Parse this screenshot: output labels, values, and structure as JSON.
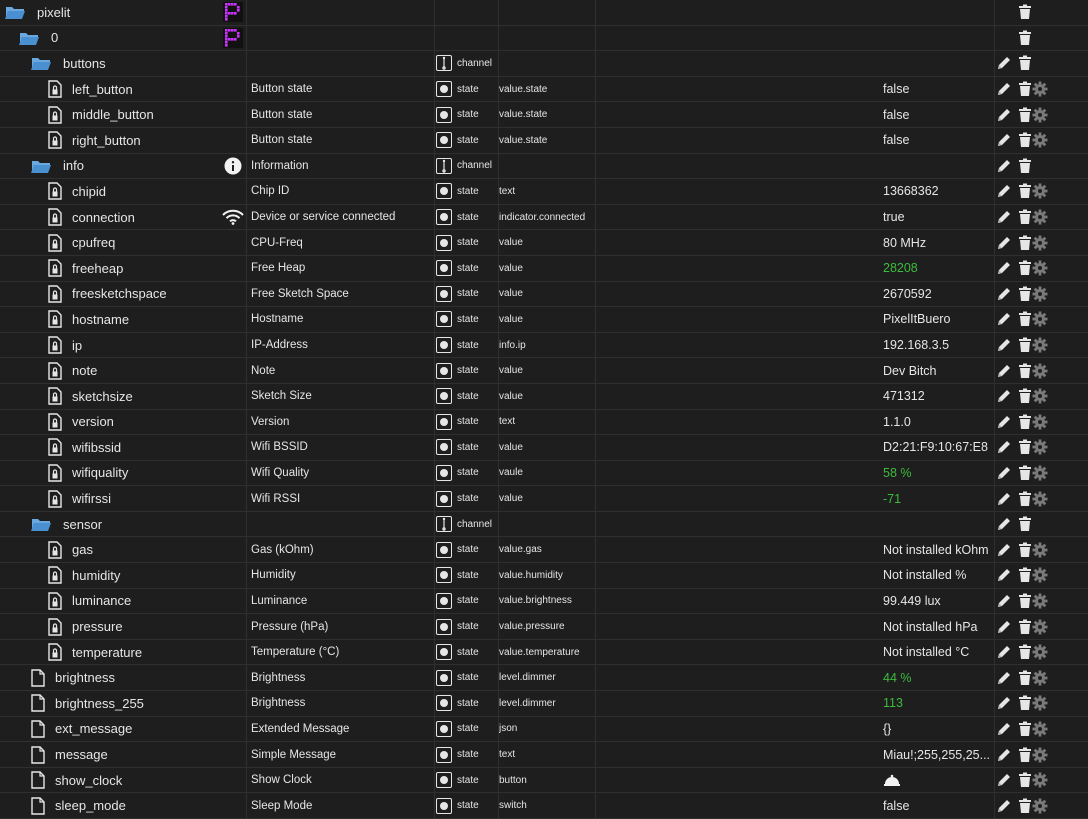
{
  "rows": [
    {
      "name": "pixelit",
      "indent": 0,
      "kind": "folder",
      "icon": "pixel-p",
      "desc": "",
      "type": "",
      "role": "",
      "value": "",
      "actions": [
        "delete"
      ]
    },
    {
      "name": "0",
      "indent": 1,
      "kind": "folder",
      "icon": "pixel-p",
      "desc": "",
      "type": "",
      "role": "",
      "value": "",
      "actions": [
        "delete"
      ]
    },
    {
      "name": "buttons",
      "indent": 2,
      "kind": "folder",
      "icon": "",
      "desc": "",
      "type": "channel",
      "role": "",
      "value": "",
      "actions": [
        "edit",
        "delete"
      ]
    },
    {
      "name": "left_button",
      "indent": 3,
      "kind": "state",
      "icon": "",
      "desc": "Button state",
      "type": "state",
      "role": "value.state",
      "value": "false",
      "actions": [
        "edit",
        "delete",
        "gear"
      ]
    },
    {
      "name": "middle_button",
      "indent": 3,
      "kind": "state",
      "icon": "",
      "desc": "Button state",
      "type": "state",
      "role": "value.state",
      "value": "false",
      "actions": [
        "edit",
        "delete",
        "gear"
      ]
    },
    {
      "name": "right_button",
      "indent": 3,
      "kind": "state",
      "icon": "",
      "desc": "Button state",
      "type": "state",
      "role": "value.state",
      "value": "false",
      "actions": [
        "edit",
        "delete",
        "gear"
      ]
    },
    {
      "name": "info",
      "indent": 2,
      "kind": "folder",
      "icon": "info",
      "desc": "Information",
      "type": "channel",
      "role": "",
      "value": "",
      "actions": [
        "edit",
        "delete"
      ]
    },
    {
      "name": "chipid",
      "indent": 3,
      "kind": "state",
      "icon": "",
      "desc": "Chip ID",
      "type": "state",
      "role": "text",
      "value": "13668362",
      "actions": [
        "edit",
        "delete",
        "gear"
      ]
    },
    {
      "name": "connection",
      "indent": 3,
      "kind": "state",
      "icon": "wifi",
      "desc": "Device or service connected",
      "type": "state",
      "role": "indicator.connected",
      "value": "true",
      "actions": [
        "edit",
        "delete",
        "gear"
      ]
    },
    {
      "name": "cpufreq",
      "indent": 3,
      "kind": "state",
      "icon": "",
      "desc": "CPU-Freq",
      "type": "state",
      "role": "value",
      "value": "80 MHz",
      "actions": [
        "edit",
        "delete",
        "gear"
      ]
    },
    {
      "name": "freeheap",
      "indent": 3,
      "kind": "state",
      "icon": "",
      "desc": "Free Heap",
      "type": "state",
      "role": "value",
      "value": "28208",
      "green": true,
      "actions": [
        "edit",
        "delete",
        "gear"
      ]
    },
    {
      "name": "freesketchspace",
      "indent": 3,
      "kind": "state",
      "icon": "",
      "desc": "Free Sketch Space",
      "type": "state",
      "role": "value",
      "value": "2670592",
      "actions": [
        "edit",
        "delete",
        "gear"
      ]
    },
    {
      "name": "hostname",
      "indent": 3,
      "kind": "state",
      "icon": "",
      "desc": "Hostname",
      "type": "state",
      "role": "value",
      "value": "PixelItBuero",
      "actions": [
        "edit",
        "delete",
        "gear"
      ]
    },
    {
      "name": "ip",
      "indent": 3,
      "kind": "state",
      "icon": "",
      "desc": "IP-Address",
      "type": "state",
      "role": "info.ip",
      "value": "192.168.3.5",
      "actions": [
        "edit",
        "delete",
        "gear"
      ]
    },
    {
      "name": "note",
      "indent": 3,
      "kind": "state",
      "icon": "",
      "desc": "Note",
      "type": "state",
      "role": "value",
      "value": "Dev Bitch",
      "actions": [
        "edit",
        "delete",
        "gear"
      ]
    },
    {
      "name": "sketchsize",
      "indent": 3,
      "kind": "state",
      "icon": "",
      "desc": "Sketch Size",
      "type": "state",
      "role": "value",
      "value": "471312",
      "actions": [
        "edit",
        "delete",
        "gear"
      ]
    },
    {
      "name": "version",
      "indent": 3,
      "kind": "state",
      "icon": "",
      "desc": "Version",
      "type": "state",
      "role": "text",
      "value": "1.1.0",
      "actions": [
        "edit",
        "delete",
        "gear"
      ]
    },
    {
      "name": "wifibssid",
      "indent": 3,
      "kind": "state",
      "icon": "",
      "desc": "Wifi BSSID",
      "type": "state",
      "role": "value",
      "value": "D2:21:F9:10:67:E8",
      "actions": [
        "edit",
        "delete",
        "gear"
      ]
    },
    {
      "name": "wifiquality",
      "indent": 3,
      "kind": "state",
      "icon": "",
      "desc": "Wifi Quality",
      "type": "state",
      "role": "vaule",
      "value": "58 %",
      "green": true,
      "actions": [
        "edit",
        "delete",
        "gear"
      ]
    },
    {
      "name": "wifirssi",
      "indent": 3,
      "kind": "state",
      "icon": "",
      "desc": "Wifi RSSI",
      "type": "state",
      "role": "value",
      "value": "-71",
      "green": true,
      "actions": [
        "edit",
        "delete",
        "gear"
      ]
    },
    {
      "name": "sensor",
      "indent": 2,
      "kind": "folder",
      "icon": "",
      "desc": "",
      "type": "channel",
      "role": "",
      "value": "",
      "actions": [
        "edit",
        "delete"
      ]
    },
    {
      "name": "gas",
      "indent": 3,
      "kind": "state",
      "icon": "",
      "desc": "Gas (kOhm)",
      "type": "state",
      "role": "value.gas",
      "value": "Not installed kOhm",
      "actions": [
        "edit",
        "delete",
        "gear"
      ]
    },
    {
      "name": "humidity",
      "indent": 3,
      "kind": "state",
      "icon": "",
      "desc": "Humidity",
      "type": "state",
      "role": "value.humidity",
      "value": "Not installed %",
      "actions": [
        "edit",
        "delete",
        "gear"
      ]
    },
    {
      "name": "luminance",
      "indent": 3,
      "kind": "state",
      "icon": "",
      "desc": "Luminance",
      "type": "state",
      "role": "value.brightness",
      "value": "99.449 lux",
      "actions": [
        "edit",
        "delete",
        "gear"
      ]
    },
    {
      "name": "pressure",
      "indent": 3,
      "kind": "state",
      "icon": "",
      "desc": "Pressure (hPa)",
      "type": "state",
      "role": "value.pressure",
      "value": "Not installed hPa",
      "actions": [
        "edit",
        "delete",
        "gear"
      ]
    },
    {
      "name": "temperature",
      "indent": 3,
      "kind": "state",
      "icon": "",
      "desc": "Temperature (°C)",
      "type": "state",
      "role": "value.temperature",
      "value": "Not installed °C",
      "actions": [
        "edit",
        "delete",
        "gear"
      ]
    },
    {
      "name": "brightness",
      "indent": 2,
      "kind": "file",
      "icon": "",
      "desc": "Brightness",
      "type": "state",
      "role": "level.dimmer",
      "value": "44 %",
      "green": true,
      "actions": [
        "edit",
        "delete",
        "gear"
      ]
    },
    {
      "name": "brightness_255",
      "indent": 2,
      "kind": "file",
      "icon": "",
      "desc": "Brightness",
      "type": "state",
      "role": "level.dimmer",
      "value": "113",
      "green": true,
      "actions": [
        "edit",
        "delete",
        "gear"
      ]
    },
    {
      "name": "ext_message",
      "indent": 2,
      "kind": "file",
      "icon": "",
      "desc": "Extended Message",
      "type": "state",
      "role": "json",
      "value": "{}",
      "actions": [
        "edit",
        "delete",
        "gear"
      ]
    },
    {
      "name": "message",
      "indent": 2,
      "kind": "file",
      "icon": "",
      "desc": "Simple Message",
      "type": "state",
      "role": "text",
      "value": "Miau!;255,255,25...",
      "actions": [
        "edit",
        "delete",
        "gear"
      ]
    },
    {
      "name": "show_clock",
      "indent": 2,
      "kind": "file",
      "icon": "",
      "desc": "Show Clock",
      "type": "state",
      "role": "button",
      "value": "",
      "valueIcon": "bell",
      "actions": [
        "edit",
        "delete",
        "gear"
      ]
    },
    {
      "name": "sleep_mode",
      "indent": 2,
      "kind": "file",
      "icon": "",
      "desc": "Sleep Mode",
      "type": "state",
      "role": "switch",
      "value": "false",
      "actions": [
        "edit",
        "delete",
        "gear"
      ]
    }
  ],
  "colors": {
    "background": "#1e1e1e",
    "text": "#e6e6e6",
    "green": "#3dbb3d",
    "pixel": "#cc33ff",
    "gear": "#7a7a7a"
  }
}
